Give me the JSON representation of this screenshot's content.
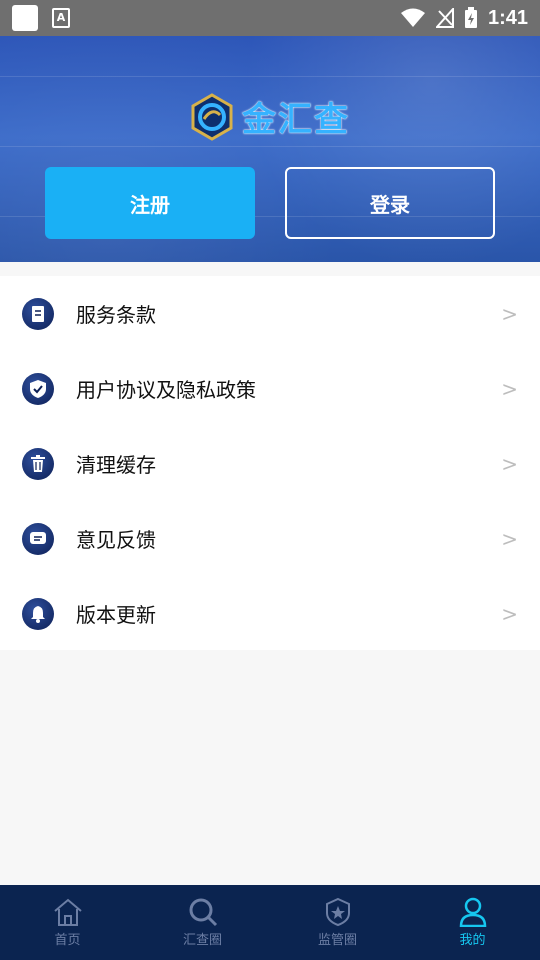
{
  "status": {
    "time": "1:41",
    "notif_a": "A"
  },
  "header": {
    "brand": "金汇查",
    "register_label": "注册",
    "login_label": "登录"
  },
  "menu": {
    "items": [
      {
        "label": "服务条款",
        "icon": "document-icon"
      },
      {
        "label": "用户协议及隐私政策",
        "icon": "shield-check-icon"
      },
      {
        "label": "清理缓存",
        "icon": "trash-icon"
      },
      {
        "label": "意见反馈",
        "icon": "chat-icon"
      },
      {
        "label": "版本更新",
        "icon": "bell-icon"
      }
    ],
    "chevron": ">"
  },
  "nav": {
    "items": [
      {
        "label": "首页",
        "icon": "home-icon"
      },
      {
        "label": "汇查圈",
        "icon": "search-icon"
      },
      {
        "label": "监管圈",
        "icon": "badge-icon"
      },
      {
        "label": "我的",
        "icon": "user-icon",
        "active": true
      }
    ]
  },
  "colors": {
    "accent": "#1ab0f5",
    "nav_bg": "#0b2450",
    "active_tab": "#16c7f0"
  }
}
